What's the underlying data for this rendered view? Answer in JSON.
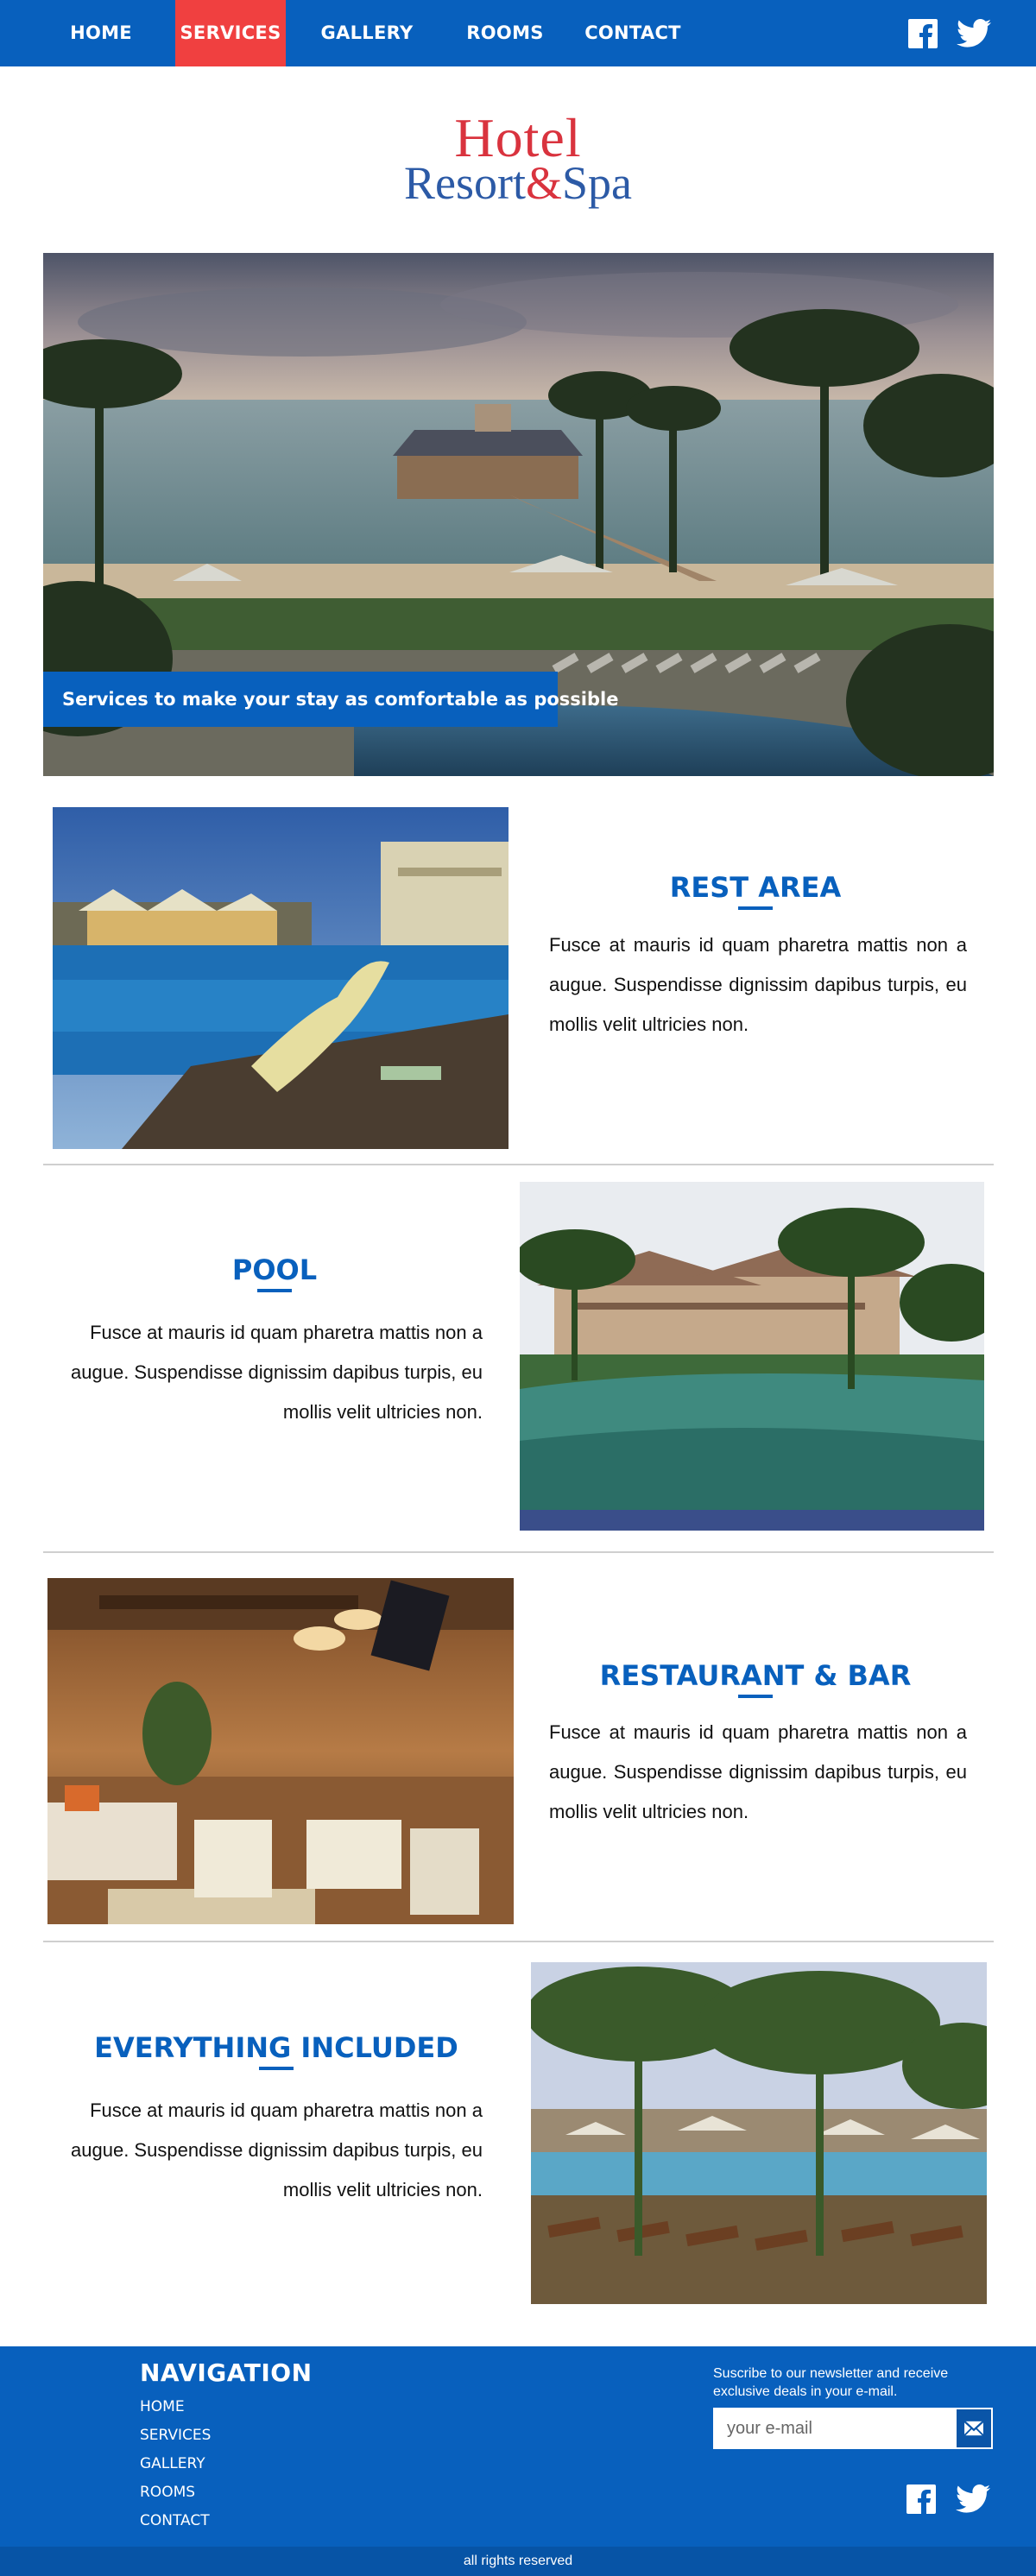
{
  "nav": {
    "items": [
      {
        "label": "HOME",
        "active": false
      },
      {
        "label": "SERVICES",
        "active": true
      },
      {
        "label": "GALLERY",
        "active": false
      },
      {
        "label": "ROOMS",
        "active": false
      },
      {
        "label": "CONTACT",
        "active": false
      }
    ],
    "social": [
      "facebook-icon",
      "twitter-icon"
    ]
  },
  "logo": {
    "line1": "Hotel",
    "line2a": "Resort",
    "amp": "&",
    "line2b": "Spa"
  },
  "hero": {
    "caption": "Services to make your stay as comfortable as possible"
  },
  "services": [
    {
      "title": "REST AREA",
      "text": "Fusce at mauris id quam pharetra mattis non a augue. Suspendisse dignissim dapibus turpis, eu mollis velit ultricies non.",
      "image": "rest-area-photo"
    },
    {
      "title": "POOL",
      "text": "Fusce at mauris id quam pharetra mattis non a augue. Suspendisse dignissim dapibus turpis, eu mollis velit ultricies non.",
      "image": "pool-photo"
    },
    {
      "title": "RESTAURANT & BAR",
      "text": "Fusce at mauris id quam pharetra mattis non a augue. Suspendisse dignissim dapibus turpis, eu mollis velit ultricies non.",
      "image": "restaurant-photo"
    },
    {
      "title": "EVERYTHING INCLUDED",
      "text": "Fusce at mauris id quam pharetra mattis non a augue. Suspendisse dignissim dapibus turpis, eu mollis velit ultricies non.",
      "image": "everything-included-photo"
    }
  ],
  "footer": {
    "title": "NAVIGATION",
    "links": [
      "HOME",
      "SERVICES",
      "GALLERY",
      "ROOMS",
      "CONTACT"
    ],
    "newsletter_text": "Suscribe to our newsletter and receive exclusive deals in your e-mail.",
    "email_placeholder": "your e-mail",
    "copyright": "all rights reserved"
  },
  "colors": {
    "brand_blue": "#0860bd",
    "active_red": "#f04040",
    "logo_red": "#d9333e",
    "logo_blue": "#2c5aa6"
  }
}
